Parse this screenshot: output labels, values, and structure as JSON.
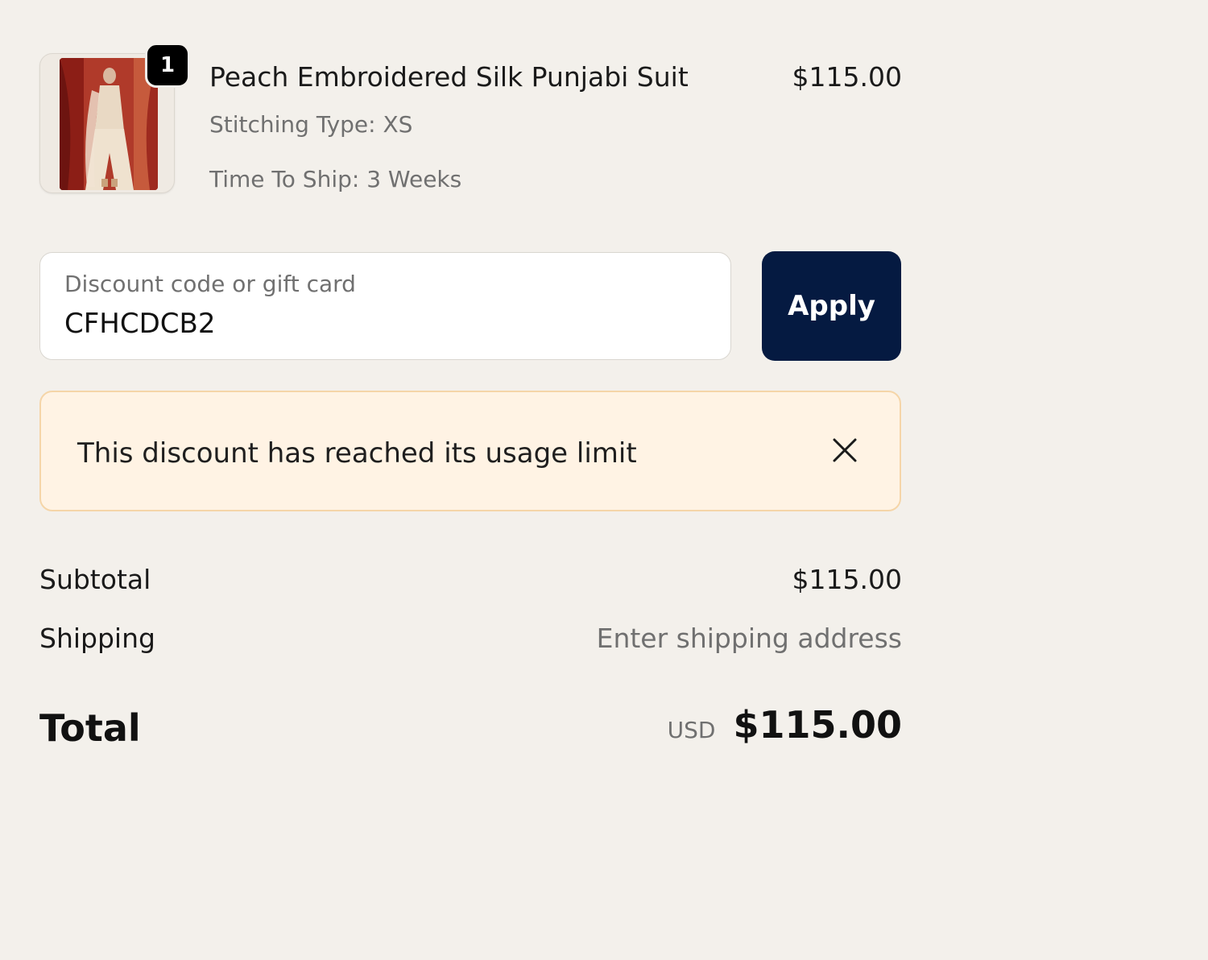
{
  "line_item": {
    "quantity": "1",
    "title": "Peach Embroidered Silk Punjabi Suit",
    "stitching": "Stitching Type: XS",
    "ship_time": "Time To Ship: 3 Weeks",
    "price": "$115.00"
  },
  "discount": {
    "label": "Discount code or gift card",
    "value": "CFHCDCB2",
    "apply_label": "Apply"
  },
  "notice": {
    "message": "This discount has reached its usage limit"
  },
  "totals": {
    "subtotal_label": "Subtotal",
    "subtotal_value": "$115.00",
    "shipping_label": "Shipping",
    "shipping_value": "Enter shipping address",
    "total_label": "Total",
    "currency": "USD",
    "total_value": "$115.00"
  },
  "colors": {
    "page_bg": "#f3f0eb",
    "apply_button": "#051a41",
    "notice_bg": "#fff3e4",
    "notice_border": "#f5d5a8"
  },
  "icons": {
    "close": "close-icon"
  }
}
